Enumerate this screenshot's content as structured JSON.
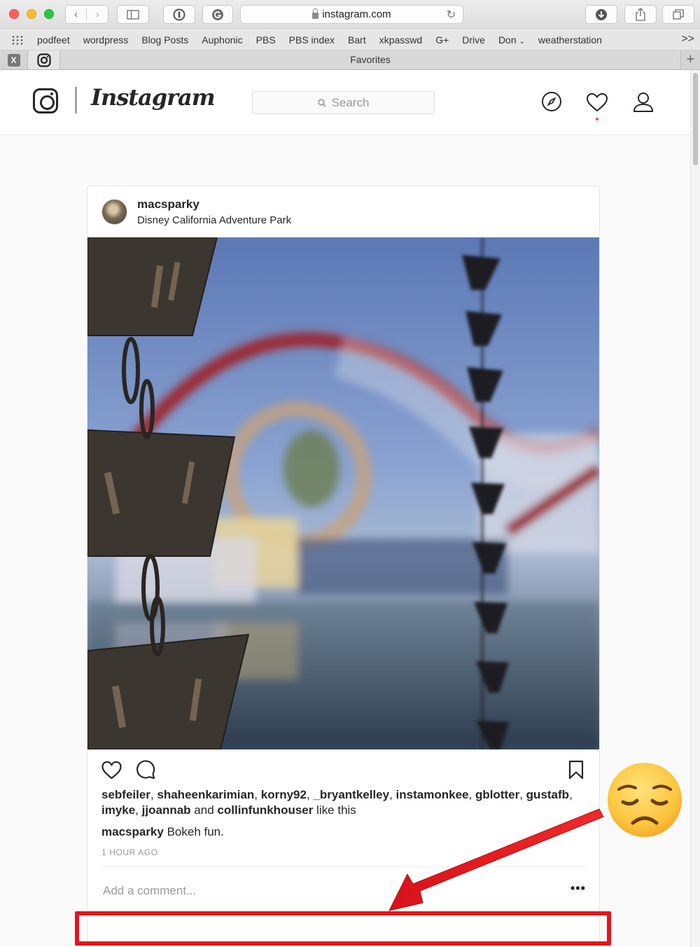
{
  "browser": {
    "url": "instagram.com",
    "bookmarks": [
      "podfeet",
      "wordpress",
      "Blog Posts",
      "Auphonic",
      "PBS",
      "PBS index",
      "Bart",
      "xkpasswd",
      "G+",
      "Drive",
      "Don",
      "weatherstation"
    ],
    "bookmarks_more": ">>",
    "tab_title": "Favorites",
    "pinned_x_label": "X"
  },
  "instagram": {
    "wordmark": "Instagram",
    "search_placeholder": "Search"
  },
  "post": {
    "username": "macsparky",
    "location": "Disney California Adventure Park",
    "liked_by": [
      "sebfeiler",
      "shaheenkarimian",
      "korny92",
      "_bryantkelley",
      "instamonkee",
      "gblotter",
      "gustafb",
      "imyke",
      "jjoannab"
    ],
    "liked_and": "and",
    "liked_last": "collinfunkhouser",
    "liked_suffix": "like this",
    "caption_user": "macsparky",
    "caption_text": "Bokeh fun.",
    "time": "1 HOUR AGO",
    "comment_placeholder": "Add a comment...",
    "more_label": "•••"
  },
  "annotation": {
    "emoji": "😞",
    "arrow_color": "#e3151a",
    "box_color": "#e3151a"
  }
}
